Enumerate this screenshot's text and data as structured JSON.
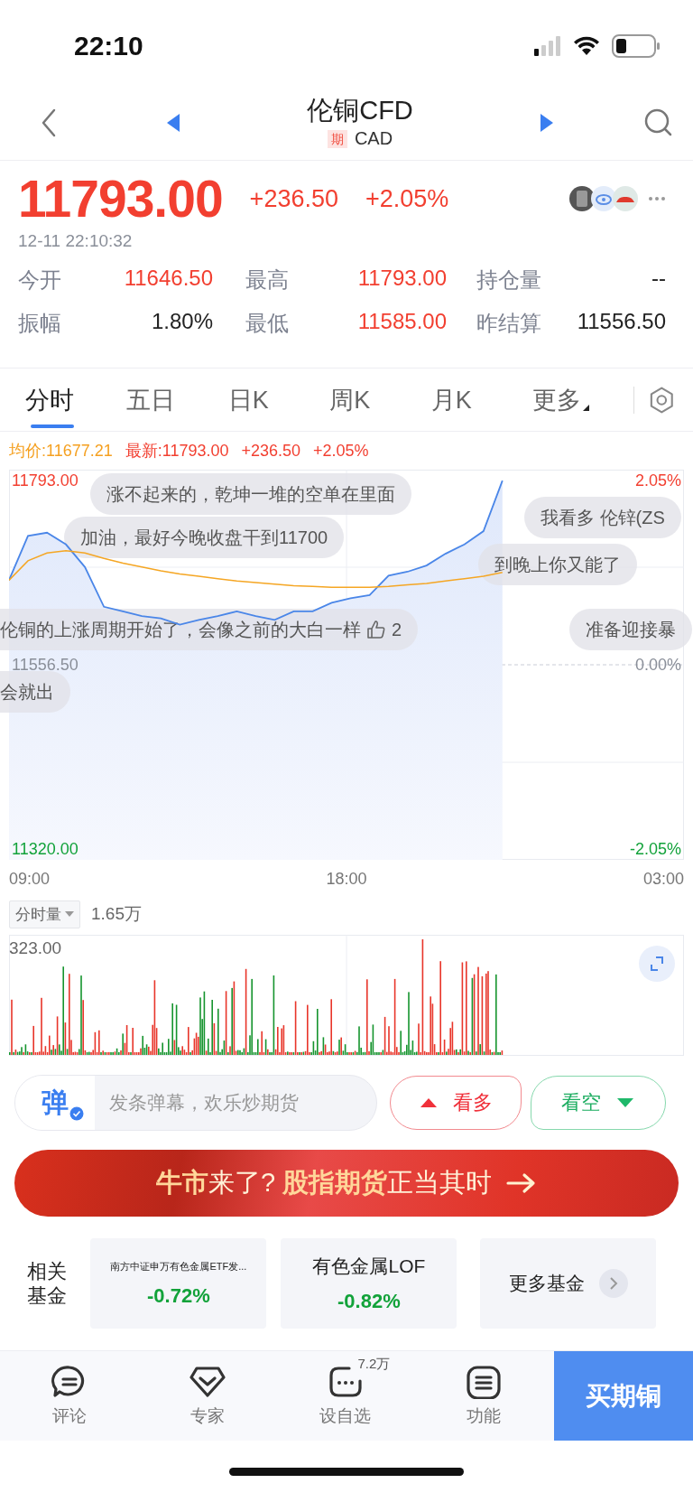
{
  "status_bar": {
    "time": "22:10"
  },
  "header": {
    "title": "伦铜CFD",
    "tag": "期",
    "code": "CAD"
  },
  "quote": {
    "price": "11793.00",
    "change": "+236.50",
    "change_pct": "+2.05%",
    "timestamp": "12-11 22:10:32"
  },
  "stats": [
    {
      "label": "今开",
      "value": "11646.50",
      "color": "#f23f30"
    },
    {
      "label": "最高",
      "value": "11793.00",
      "color": "#f23f30"
    },
    {
      "label": "持仓量",
      "value": "--",
      "color": "#222222"
    },
    {
      "label": "振幅",
      "value": "1.80%",
      "color": "#222222"
    },
    {
      "label": "最低",
      "value": "11585.00",
      "color": "#f23f30"
    },
    {
      "label": "昨结算",
      "value": "11556.50",
      "color": "#222222"
    }
  ],
  "tabs": [
    {
      "label": "分时",
      "selected": true
    },
    {
      "label": "五日",
      "selected": false
    },
    {
      "label": "日K",
      "selected": false
    },
    {
      "label": "周K",
      "selected": false
    },
    {
      "label": "月K",
      "selected": false
    },
    {
      "label": "更多",
      "selected": false,
      "dropdown": true
    }
  ],
  "legend": [
    {
      "text": "均价:11677.21",
      "kind": "avg"
    },
    {
      "text": "最新:11793.00",
      "kind": "last"
    },
    {
      "text": "+236.50",
      "kind": "last"
    },
    {
      "text": "+2.05%",
      "kind": "last"
    }
  ],
  "price_chart": {
    "time_axis": [
      "09:00",
      "18:00",
      "03:00"
    ],
    "right_labels": [
      {
        "text": "2.05%",
        "color": "#f23f30"
      },
      {
        "text": "0.00%",
        "color": "#8a8f99"
      },
      {
        "text": "-2.05%",
        "color": "#12a23a"
      }
    ],
    "chart_data": {
      "type": "area",
      "ylim": [
        11306,
        11807
      ],
      "yticks": [
        {
          "value": 11793,
          "label": "11793.00"
        },
        {
          "value": 11556.5,
          "label": "11556.50"
        },
        {
          "value": 11320,
          "label": "11320.00"
        }
      ],
      "categories": [
        null,
        null,
        null,
        null,
        null,
        null,
        null,
        null,
        null,
        null,
        null,
        null,
        null,
        null,
        null,
        null,
        null,
        null,
        null,
        null,
        null,
        null,
        null,
        null,
        null,
        null,
        null
      ],
      "series": [
        {
          "color": "#4a86e8",
          "values": [
            11665,
            11722,
            11726,
            11711,
            11682,
            11631,
            11625,
            11619,
            11616,
            11608,
            11614,
            11619,
            11625,
            11619,
            11614,
            11625,
            11625,
            11636,
            11642,
            11646,
            11671,
            11676,
            11684,
            11699,
            11711,
            11728,
            11793
          ]
        },
        {
          "color": "#f5a623",
          "type": "line",
          "values": [
            11665,
            11690,
            11700,
            11703,
            11700,
            11693,
            11687,
            11682,
            11677,
            11673,
            11670,
            11667,
            11664,
            11662,
            11660,
            11658,
            11657,
            11656,
            11656,
            11656,
            11657,
            11659,
            11661,
            11664,
            11667,
            11670,
            11675
          ]
        }
      ]
    },
    "comments": [
      {
        "text": "涨不起来的，乾坤一堆的空单在里面"
      },
      {
        "text": "我看多 伦锌(ZS"
      },
      {
        "text": "加油，最好今晚收盘干到11700"
      },
      {
        "text": "到晚上你又能了"
      },
      {
        "text": "伦铜的上涨周期开始了，会像之前的大白一样",
        "likes": "2"
      },
      {
        "text": "准备迎接暴"
      },
      {
        "text": "会就出"
      }
    ]
  },
  "volume": {
    "label": "分时量",
    "total": "1.65万",
    "max_label": "323.00"
  },
  "comment_bar": {
    "badge": "弹",
    "placeholder": "发条弹幕，欢乐炒期货",
    "buttons": [
      {
        "label": "看多",
        "kind": "bull"
      },
      {
        "label": "看空",
        "kind": "bear"
      }
    ]
  },
  "banner": {
    "text": "**牛市**来了? **股指期货**正当其时"
  },
  "funds": {
    "label": "相关基金",
    "items": [
      {
        "name": "南方中证申万有色金属ETF发...",
        "change": "-0.72%"
      },
      {
        "name": "有色金属LOF",
        "change": "-0.82%"
      }
    ],
    "more": "更多基金"
  },
  "nav": [
    {
      "label": "评论",
      "kind": "comment"
    },
    {
      "label": "专家",
      "kind": "expert"
    },
    {
      "label": "设自选",
      "kind": "watch",
      "badge": "7.2万"
    },
    {
      "label": "功能",
      "kind": "menu"
    }
  ],
  "buy": "买期铜"
}
